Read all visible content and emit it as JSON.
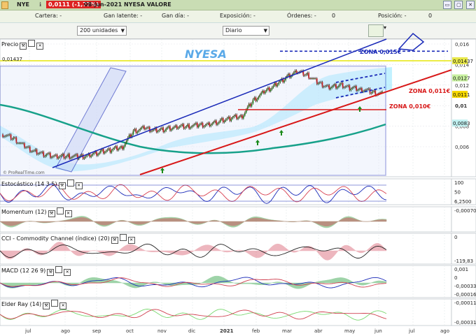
{
  "titlebar": {
    "symbol": "NYE",
    "info_glyph": "ℹ",
    "price_change": "0,0111 (-1,77%)",
    "date_title": "08-jun-2021 NYESA VALORE",
    "buttons": [
      "▭",
      "▢",
      "✕"
    ]
  },
  "infobar": {
    "cartera": "Cartera: -",
    "gan_latente": "Gan latente: -",
    "gan_dia": "Gan día: -",
    "exposicion": "Exposición: -",
    "ordenes": "Órdenes: -",
    "ordenes_count": "0",
    "posicion": "Posición: -",
    "posicion_count": "0"
  },
  "toolbar": {
    "units_select": "200 unidades",
    "period_select": "Diario"
  },
  "chart_data": [
    {
      "type": "candlestick",
      "panel": "Precio",
      "watermark": "NYESA",
      "x_ticks": [
        "jul",
        "ago",
        "sep",
        "oct",
        "nov",
        "dic",
        "2021",
        "feb",
        "mar",
        "abr",
        "may",
        "jun",
        "jul",
        "ago"
      ],
      "y_ticks": [
        "0,016",
        "0,014",
        "0,012",
        "0,01",
        "0,008",
        "0,006"
      ],
      "price_levels": [
        {
          "label": "0,01437",
          "value": 0.01437,
          "color": "#e8e84a"
        },
        {
          "label": "0,0127",
          "value": 0.0127,
          "color": "#c8f0a0"
        },
        {
          "label": "0,0111",
          "value": 0.0111,
          "color": "#f6d800"
        },
        {
          "label": "0,0083",
          "value": 0.0083,
          "color": "#c0f0f0"
        }
      ],
      "annotations": [
        {
          "text": "ZONA 0,015€",
          "color": "#1a2ab8"
        },
        {
          "text": "ZONA 0,011€",
          "color": "#d81818"
        },
        {
          "text": "ZONA 0,010€",
          "color": "#d81818"
        }
      ],
      "credit": "© ProRealTime.com",
      "close_series": [
        0.0072,
        0.0068,
        0.006,
        0.0055,
        0.0052,
        0.005,
        0.0051,
        0.005,
        0.0052,
        0.0055,
        0.0057,
        0.006,
        0.0075,
        0.0078,
        0.0076,
        0.0077,
        0.0079,
        0.008,
        0.0081,
        0.0082,
        0.0085,
        0.0088,
        0.009,
        0.0105,
        0.0113,
        0.012,
        0.0127,
        0.0133,
        0.013,
        0.0122,
        0.0118,
        0.012,
        0.0117,
        0.0116,
        0.0113,
        0.0111
      ]
    },
    {
      "type": "oscillator",
      "panel": "Estocástico (14 3 5)",
      "y_ticks": [
        "100",
        "50",
        "6,2500"
      ],
      "ylim": [
        0,
        100
      ]
    },
    {
      "type": "histogram",
      "panel": "Momentum (12)",
      "y_ticks": [
        "-0,00070"
      ]
    },
    {
      "type": "histogram",
      "panel": "CCI - Commodity Channel (índice) (20)",
      "y_ticks": [
        "0",
        "-119,83"
      ]
    },
    {
      "type": "macd",
      "panel": "MACD (12 26 9)",
      "y_ticks": [
        "0,001",
        "0",
        "-0,00033",
        "-0,00016"
      ]
    },
    {
      "type": "histogram",
      "panel": "Elder Ray (14)",
      "y_ticks": [
        "-0,00011",
        "-0,00031"
      ]
    }
  ],
  "colors": {
    "bull": "#1a8a1a",
    "bear": "#c21c1c",
    "trend_blue": "#1a2ab8",
    "trend_red": "#d81818",
    "mm200": "#17a18a",
    "cloud": "#8fe6ff"
  }
}
